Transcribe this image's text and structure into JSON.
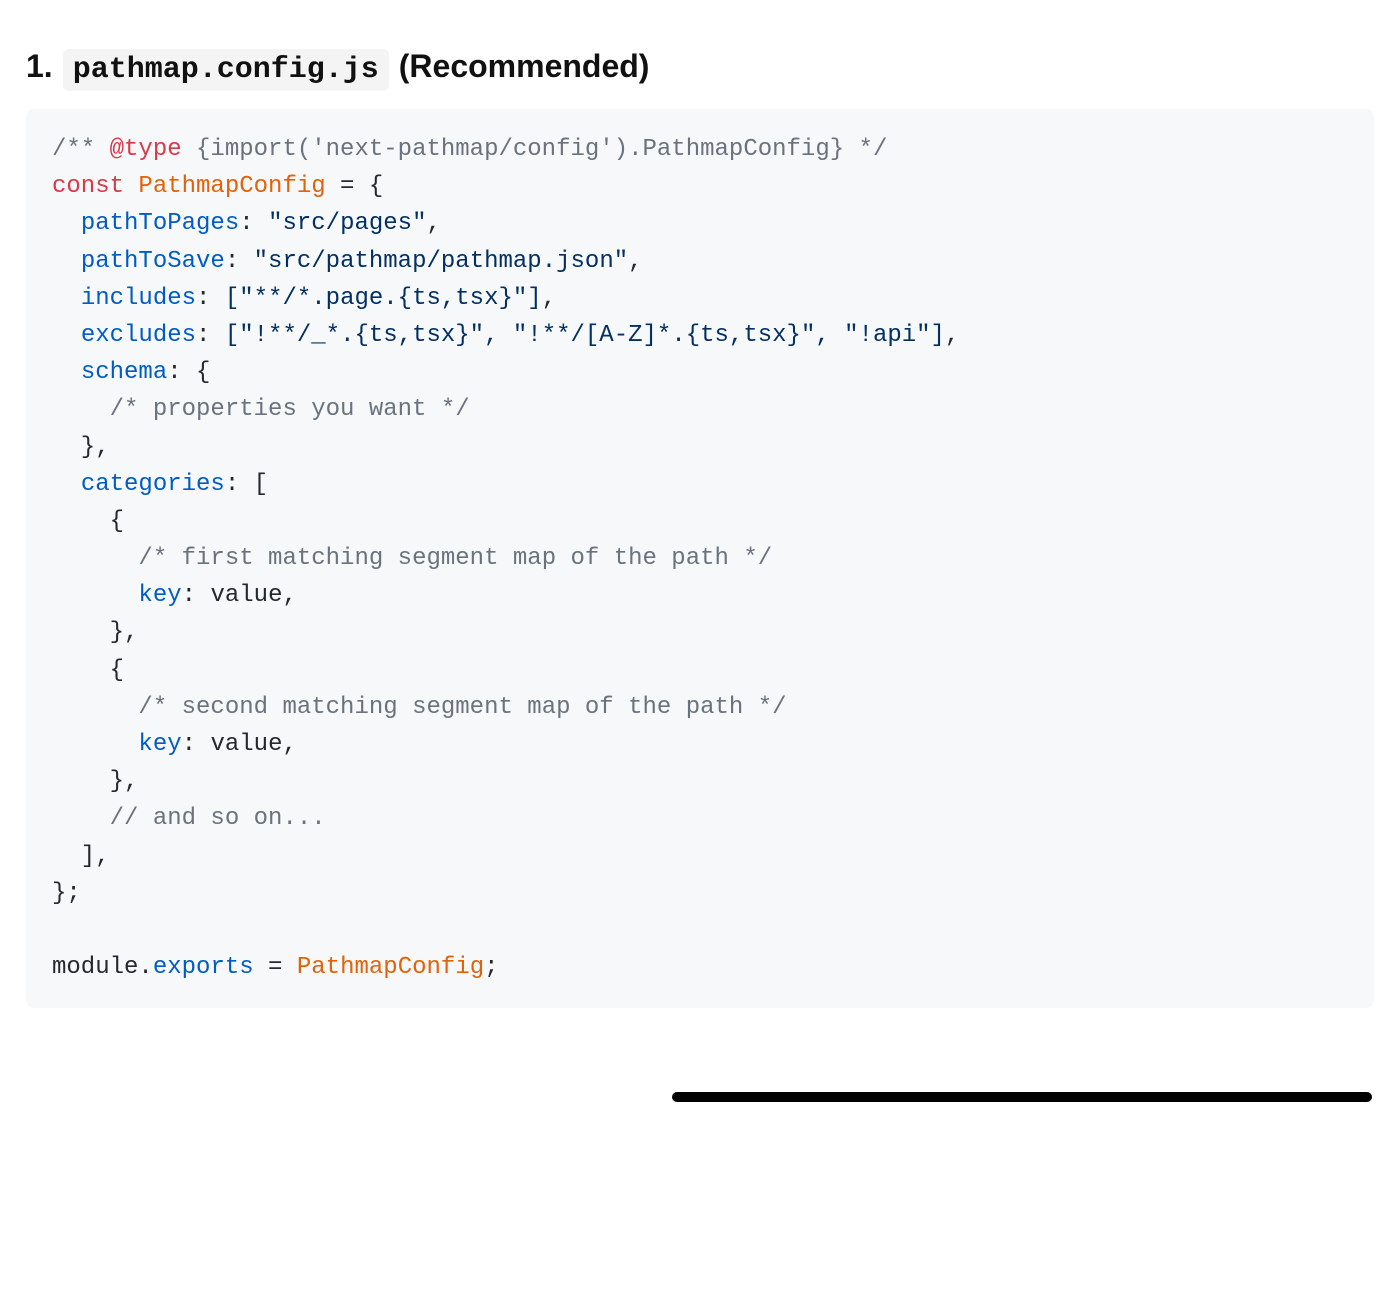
{
  "heading": {
    "number": "1.",
    "filename": "pathmap.config.js",
    "annotation": "(Recommended)"
  },
  "code": {
    "l1": {
      "open": "/** ",
      "at": "@type",
      "rest": " {import('next-pathmap/config').PathmapConfig} */"
    },
    "l2": {
      "const": "const",
      "name": " PathmapConfig",
      "eq": " = {"
    },
    "l3": {
      "prop": "pathToPages",
      "val": "\"src/pages\""
    },
    "l4": {
      "prop": "pathToSave",
      "val": "\"src/pathmap/pathmap.json\""
    },
    "l5": {
      "prop": "includes",
      "val": "[\"**/*.page.{ts,tsx}\"]"
    },
    "l6": {
      "prop": "excludes",
      "val": "[\"!**/_*.{ts,tsx}\", \"!**/[A-Z]*.{ts,tsx}\", \"!api\"]"
    },
    "l7": {
      "prop": "schema",
      "open": ": {"
    },
    "l8": "/* properties you want */",
    "l9": "  },",
    "l10": {
      "prop": "categories",
      "open": ": ["
    },
    "l11": "    {",
    "l12": "/* first matching segment map of the path */",
    "l13": {
      "prop": "key",
      "val": "value"
    },
    "l14": "    },",
    "l15": "    {",
    "l16": "/* second matching segment map of the path */",
    "l17": {
      "prop": "key",
      "val": "value"
    },
    "l18": "    },",
    "l19": "// and so on...",
    "l20": "  ],",
    "l21": "};",
    "l22": {
      "mod": "module.",
      "exp": "exports",
      "eq": " = ",
      "name": "PathmapConfig",
      "semi": ";"
    }
  }
}
